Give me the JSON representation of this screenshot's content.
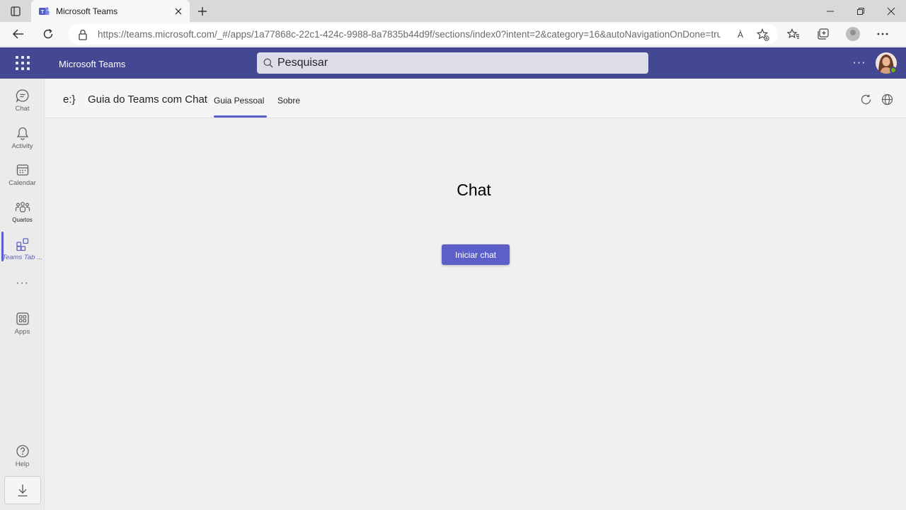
{
  "browser": {
    "tab_title": "Microsoft Teams",
    "url": "https://teams.microsoft.com/_#/apps/1a77868c-22c1-424c-9988-8a7835b44d9f/sections/index0?intent=2&category=16&autoNavigationOnDone=true...",
    "read_aloud": "À"
  },
  "teams": {
    "app_name": "Microsoft Teams",
    "search_placeholder": "Pesquisar",
    "more": "···"
  },
  "rail": {
    "items": [
      {
        "label": "Chat",
        "icon": "chat-icon"
      },
      {
        "label": "Activity",
        "icon": "bell-icon"
      },
      {
        "label": "Calendar",
        "icon": "calendar-icon"
      },
      {
        "label": "Quartos",
        "icon": "people-icon"
      },
      {
        "label": "Teams Tab ...",
        "icon": "apps-add-icon"
      },
      {
        "label": "Apps",
        "icon": "apps-grid-icon"
      },
      {
        "label": "Help",
        "icon": "help-icon"
      }
    ],
    "more": "···"
  },
  "app_tab": {
    "icon_text": "e:}",
    "title": "Guia do Teams com Chat",
    "tabs": [
      {
        "label": "Guia Pessoal",
        "active": true
      },
      {
        "label": "Sobre",
        "active": false
      }
    ]
  },
  "content": {
    "heading": "Chat",
    "button_label": "Iniciar chat"
  },
  "colors": {
    "teams_header": "#444791",
    "accent": "#5b5fc7"
  }
}
